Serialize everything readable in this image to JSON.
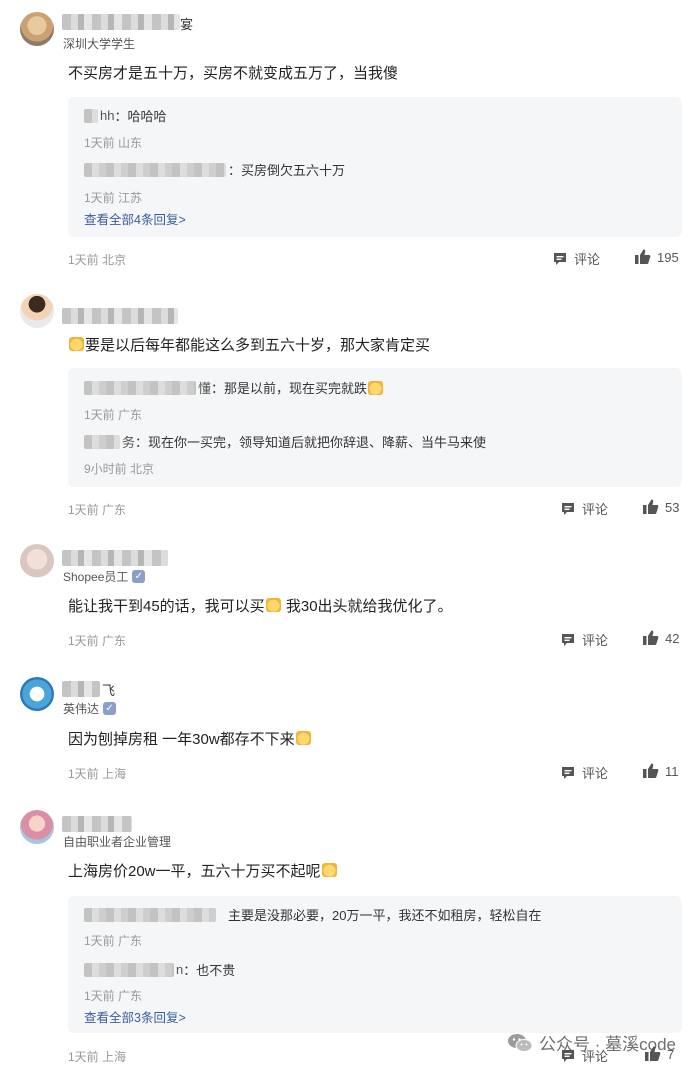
{
  "icons": {
    "comment": "comment-icon",
    "like": "thumbs-up-icon",
    "verified": "verified-badge-icon",
    "emoji": "emoji-icon",
    "wechat": "wechat-icon"
  },
  "colors": {
    "link": "#3a5d9c",
    "reply_bg": "#f5f6f8",
    "meta": "#999999"
  },
  "comments": [
    {
      "name_tail": "宴",
      "subtitle": "深圳大学学生",
      "text": "不买房才是五十万，买房不就变成五万了，当我傻",
      "replies": [
        {
          "name": "hh",
          "text": "：哈哈哈",
          "time": "1天前",
          "location": "山东"
        },
        {
          "name": "",
          "text": "：买房倒欠五六十万",
          "time": "1天前",
          "location": "江苏"
        }
      ],
      "more": "查看全部4条回复>",
      "time": "1天前",
      "location": "北京",
      "comment_label": "评论",
      "likes": "195"
    },
    {
      "name_tail": "",
      "subtitle": "",
      "text": "要是以后每年都能这么多到五六十岁，那大家肯定买",
      "replies": [
        {
          "name": "懂",
          "text": "：那是以前，现在买完就跌",
          "time": "1天前",
          "location": "广东"
        },
        {
          "name": "务",
          "text": "：现在你一买完，领导知道后就把你辞退、降薪、当牛马来使",
          "time": "9小时前",
          "location": "北京"
        }
      ],
      "more": "",
      "time": "1天前",
      "location": "广东",
      "comment_label": "评论",
      "likes": "53"
    },
    {
      "name_tail": "",
      "subtitle": "Shopee员工",
      "text_a": "能让我干到45的话，我可以买",
      "text_b": " 我30出头就给我优化了。",
      "time": "1天前",
      "location": "广东",
      "comment_label": "评论",
      "likes": "42"
    },
    {
      "name_tail": "飞",
      "subtitle": "英伟达",
      "text": "因为刨掉房租 一年30w都存不下来",
      "time": "1天前",
      "location": "上海",
      "comment_label": "评论",
      "likes": "11"
    },
    {
      "name_tail": "",
      "subtitle": "自由职业者企业管理",
      "text": "上海房价20w一平，五六十万买不起呢",
      "replies": [
        {
          "name": "",
          "text": "主要是没那必要，20万一平，我还不如租房，轻松自在",
          "time": "1天前",
          "location": "广东"
        },
        {
          "name": "n",
          "text": "：也不贵",
          "time": "1天前",
          "location": "广东"
        }
      ],
      "more": "查看全部3条回复>",
      "time": "1天前",
      "location": "上海",
      "comment_label": "评论",
      "likes": "7"
    }
  ],
  "watermark": "公众号 · 墓溪code"
}
